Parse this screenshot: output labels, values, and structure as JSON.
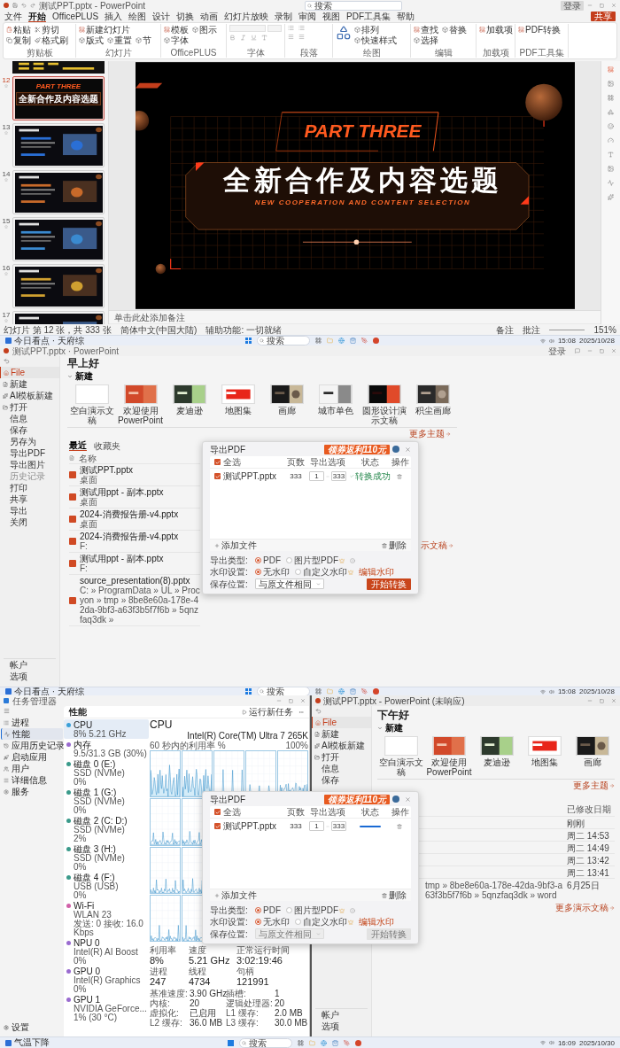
{
  "editor": {
    "title": "测试PPT.pptx - PowerPoint",
    "search_placeholder": "搜索",
    "sign_in": "登录",
    "menu_tabs": [
      {
        "label": "文件",
        "selected": false
      },
      {
        "label": "开始",
        "selected": true
      },
      {
        "label": "OfficePLUS",
        "selected": false
      },
      {
        "label": "插入",
        "selected": false
      },
      {
        "label": "绘图",
        "selected": false
      },
      {
        "label": "设计",
        "selected": false
      },
      {
        "label": "切换",
        "selected": false
      },
      {
        "label": "动画",
        "selected": false
      },
      {
        "label": "幻灯片放映",
        "selected": false
      },
      {
        "label": "录制",
        "selected": false
      },
      {
        "label": "审阅",
        "selected": false
      },
      {
        "label": "视图",
        "selected": false
      },
      {
        "label": "PDF工具集",
        "selected": false
      },
      {
        "label": "帮助",
        "selected": false
      }
    ],
    "share": "共享",
    "ribbon_groups": [
      {
        "label": "剪贴板",
        "kind": "buttons",
        "buttons": [
          "粘贴",
          "剪切",
          "复制",
          "格式刷"
        ]
      },
      {
        "label": "幻灯片",
        "kind": "buttons",
        "buttons": [
          "新建幻灯片",
          "版式",
          "重置",
          "节"
        ]
      },
      {
        "label": "OfficePLUS",
        "kind": "buttons",
        "buttons": [
          "模板",
          "图示",
          "字体"
        ]
      },
      {
        "label": "字体",
        "kind": "font"
      },
      {
        "label": "段落",
        "kind": "paragraph"
      },
      {
        "label": "绘图",
        "kind": "drawing",
        "buttons": [
          "排列",
          "快速样式"
        ]
      },
      {
        "label": "编辑",
        "kind": "buttons",
        "buttons": [
          "查找",
          "替换",
          "选择"
        ]
      },
      {
        "label": "加载项",
        "kind": "buttons",
        "buttons": [
          "加载项"
        ]
      },
      {
        "label": "PDF工具集",
        "kind": "buttons",
        "buttons": [
          "PDF转换"
        ]
      }
    ],
    "thumbnails": [
      {
        "number": "12",
        "selected": true,
        "kind": "title",
        "part": "PART THREE",
        "title": "全新合作及内容选题"
      },
      {
        "number": "13",
        "selected": false,
        "kind": "picture"
      },
      {
        "number": "14",
        "selected": false,
        "kind": "picture"
      },
      {
        "number": "15",
        "selected": false,
        "kind": "picture"
      },
      {
        "number": "16",
        "selected": false,
        "kind": "picture"
      },
      {
        "number": "17",
        "selected": false,
        "kind": "picture"
      }
    ],
    "slide": {
      "part": "PART THREE",
      "title": "全新合作及内容选题",
      "subtitle": "NEW COOPERATION AND CONTENT SELECTION"
    },
    "notes_placeholder": "单击此处添加备注",
    "status_bar": {
      "slide": "幻灯片 第 12 张，共 333 张",
      "language": "简体中文(中国大陆)",
      "accessibility": "辅助功能: 一切就绪",
      "notes": "备注",
      "comments": "批注",
      "zoom": "151%"
    }
  },
  "taskbar_1": {
    "news": "今日看点 · 天府综",
    "search_placeholder": "搜索",
    "time": "15:08",
    "date": "2025/10/28"
  },
  "backstage": {
    "title": "测试PPT.pptx · PowerPoint",
    "sign_in": "登录",
    "greeting": "早上好",
    "new_heading": "新建",
    "nav": [
      {
        "label": "File",
        "selected": true,
        "disabled": false
      },
      {
        "label": "新建",
        "selected": false,
        "disabled": false
      },
      {
        "label": "AI模板新建",
        "selected": false,
        "disabled": false
      },
      {
        "label": "打开",
        "selected": false,
        "disabled": false
      },
      {
        "label": "信息",
        "selected": false,
        "disabled": false
      },
      {
        "label": "保存",
        "selected": false,
        "disabled": false
      },
      {
        "label": "另存为",
        "selected": false,
        "disabled": false
      },
      {
        "label": "导出PDF",
        "selected": false,
        "disabled": false
      },
      {
        "label": "导出图片",
        "selected": false,
        "disabled": false
      },
      {
        "label": "历史记录",
        "selected": false,
        "disabled": true
      },
      {
        "label": "打印",
        "selected": false,
        "disabled": false
      },
      {
        "label": "共享",
        "selected": false,
        "disabled": false
      },
      {
        "label": "导出",
        "selected": false,
        "disabled": false
      },
      {
        "label": "关闭",
        "selected": false,
        "disabled": false
      }
    ],
    "nav_bottom": [
      "帐户",
      "选项"
    ],
    "templates": [
      "空白演示文稿",
      "欢迎使用 PowerPoint",
      "麦迪逊",
      "地图集",
      "画廊",
      "城市单色",
      "圆形设计演示文稿",
      "积尘画廊"
    ],
    "more_themes": "更多主题",
    "tabs": [
      {
        "label": "最近",
        "selected": true
      },
      {
        "label": "收藏夹",
        "selected": false
      }
    ],
    "name_column": "名称",
    "files": [
      {
        "name": "测试PPT.pptx",
        "location": "桌面"
      },
      {
        "name": "测试用ppt - 副本.pptx",
        "location": "桌面"
      },
      {
        "name": "2024-消费报告册-v4.pptx",
        "location": "桌面"
      },
      {
        "name": "2024-消费报告册-v4.pptx",
        "location": "F:"
      },
      {
        "name": "测试用ppt - 副本.pptx",
        "location": "F:"
      },
      {
        "name": "source_presentation(8).pptx",
        "location": "C: » ProgramData » UL » Procyon » tmp » 8be8e60a-178e-42da-9bf3-a63f3b5f7f6b » 5qnzfaq3dk »"
      }
    ],
    "more_files": "示文稿"
  },
  "export_dialog_1": {
    "title": "导出PDF",
    "promo": "领券返利110元",
    "columns": [
      "全选",
      "页数",
      "导出选项",
      "状态",
      "操作"
    ],
    "select_all": true,
    "files": [
      {
        "name": "测试PPT.pptx",
        "checked": true,
        "pages": "333",
        "from": "1",
        "to": "333",
        "status": {
          "kind": "done",
          "text": "转换成功"
        }
      }
    ],
    "add_file": "添加文件",
    "delete": "删除",
    "export_type": {
      "label": "导出类型:",
      "options": [
        {
          "label": "PDF",
          "selected": true,
          "premium": false
        },
        {
          "label": "图片型PDF",
          "selected": false,
          "premium": true
        }
      ]
    },
    "watermark": {
      "label": "水印设置:",
      "options": [
        {
          "label": "无水印",
          "selected": true,
          "premium": false
        },
        {
          "label": "自定义水印",
          "selected": false,
          "premium": true
        }
      ],
      "edit": "编辑水印"
    },
    "save_location": {
      "label": "保存位置:",
      "value": "与原文件相同",
      "disabled": false
    },
    "start": {
      "label": "开始转换",
      "disabled": false
    }
  },
  "taskbar_2": {
    "news": "今日看点 · 天府综",
    "search_placeholder": "搜索",
    "time": "15:08",
    "date": "2025/10/28"
  },
  "task_manager": {
    "title": "任务管理器",
    "nav": [
      {
        "label": "进程",
        "selected": false
      },
      {
        "label": "性能",
        "selected": true
      },
      {
        "label": "应用历史记录",
        "selected": false
      },
      {
        "label": "启动应用",
        "selected": false
      },
      {
        "label": "用户",
        "selected": false
      },
      {
        "label": "详细信息",
        "selected": false
      },
      {
        "label": "服务",
        "selected": false
      }
    ],
    "settings": "设置",
    "header": "性能",
    "run_task": "运行新任务",
    "devices": [
      {
        "name": "CPU",
        "lines": [
          "8% 5.21 GHz"
        ],
        "selected": true,
        "color": "#3aa0d8"
      },
      {
        "name": "内存",
        "lines": [
          "9.5/31.3 GB (30%)"
        ],
        "selected": false,
        "color": "#9a6bd0"
      },
      {
        "name": "磁盘 0 (E:)",
        "lines": [
          "SSD (NVMe)",
          "0%"
        ],
        "selected": false,
        "color": "#3a9a8a"
      },
      {
        "name": "磁盘 1 (G:)",
        "lines": [
          "SSD (NVMe)",
          "0%"
        ],
        "selected": false,
        "color": "#3a9a8a"
      },
      {
        "name": "磁盘 2 (C: D:)",
        "lines": [
          "SSD (NVMe)",
          "2%"
        ],
        "selected": false,
        "color": "#3a9a8a"
      },
      {
        "name": "磁盘 3 (H:)",
        "lines": [
          "SSD (NVMe)",
          "0%"
        ],
        "selected": false,
        "color": "#3a9a8a"
      },
      {
        "name": "磁盘 4 (F:)",
        "lines": [
          "USB (USB)",
          "0%"
        ],
        "selected": false,
        "color": "#3a9a8a"
      },
      {
        "name": "Wi-Fi",
        "lines": [
          "WLAN 23",
          "发送: 0 接收: 16.0 Kbps"
        ],
        "selected": false,
        "color": "#d060a8"
      },
      {
        "name": "NPU 0",
        "lines": [
          "Intel(R) AI Boost",
          "0%"
        ],
        "selected": false,
        "color": "#9a6bd0"
      },
      {
        "name": "GPU 0",
        "lines": [
          "Intel(R) Graphics",
          "0%"
        ],
        "selected": false,
        "color": "#9a6bd0"
      },
      {
        "name": "GPU 1",
        "lines": [
          "NVIDIA GeForce...",
          "1% (30 °C)"
        ],
        "selected": false,
        "color": "#9a6bd0"
      }
    ],
    "cpu": {
      "title": "CPU",
      "model": "Intel(R) Core(TM) Ultra 7 265K",
      "graph_label": "60 秒内的利用率 %",
      "graph_max": "100%",
      "stats": [
        {
          "label": "利用率",
          "value": "8%"
        },
        {
          "label": "速度",
          "value": "5.21 GHz"
        },
        {
          "label": "正常运行时间",
          "value": "3:02:19:46"
        },
        {
          "label": "进程",
          "value": "247"
        },
        {
          "label": "线程",
          "value": "4734"
        },
        {
          "label": "句柄",
          "value": "121991"
        }
      ],
      "specs": [
        {
          "label": "基准速度:",
          "value": "3.90 GHz"
        },
        {
          "label": "插槽:",
          "value": "1"
        },
        {
          "label": "内核:",
          "value": "20"
        },
        {
          "label": "逻辑处理器:",
          "value": "20"
        },
        {
          "label": "虚拟化:",
          "value": "已启用"
        },
        {
          "label": "L1 缓存:",
          "value": "2.0 MB"
        },
        {
          "label": "L2 缓存:",
          "value": "36.0 MB"
        },
        {
          "label": "L3 缓存:",
          "value": "30.0 MB"
        }
      ]
    }
  },
  "backstage_2": {
    "title": "测试PPT.pptx - PowerPoint (未响应)",
    "greeting": "下午好",
    "new_heading": "新建",
    "nav": [
      {
        "label": "File",
        "selected": true
      },
      {
        "label": "新建",
        "selected": false
      },
      {
        "label": "AI模板新建",
        "selected": false
      },
      {
        "label": "打开",
        "selected": false
      },
      {
        "label": "信息",
        "selected": false
      },
      {
        "label": "保存",
        "selected": false
      }
    ],
    "nav_bottom": [
      "帐户",
      "选项"
    ],
    "templates": [
      "空白演示文稿",
      "欢迎使用 PowerPoint",
      "麦迪逊",
      "地图集",
      "画廊"
    ],
    "more_themes": "更多主题",
    "date_column": "已修改日期",
    "dates": [
      "刚刚",
      "周二 14:53",
      "周二 14:49",
      "周二 13:42",
      "周二 13:41",
      "6月25日"
    ],
    "path_tail": "tmp » 8be8e60a-178e-42da-9bf3-a63f3b5f7f6b » 5qnzfaq3dk » word",
    "more_files": "更多演示文稿"
  },
  "export_dialog_2": {
    "title": "导出PDF",
    "promo": "领券返利110元",
    "columns": [
      "全选",
      "页数",
      "导出选项",
      "状态",
      "操作"
    ],
    "select_all": true,
    "files": [
      {
        "name": "测试PPT.pptx",
        "checked": true,
        "pages": "333",
        "from": "1",
        "to": "333",
        "status": {
          "kind": "progress",
          "level": 1
        }
      }
    ],
    "add_file": "添加文件",
    "delete": "删除",
    "export_type": {
      "label": "导出类型:",
      "options": [
        {
          "label": "PDF",
          "selected": true,
          "premium": false
        },
        {
          "label": "图片型PDF",
          "selected": false,
          "premium": true
        }
      ]
    },
    "watermark": {
      "label": "水印设置:",
      "options": [
        {
          "label": "无水印",
          "selected": true,
          "premium": false
        },
        {
          "label": "自定义水印",
          "selected": false,
          "premium": true
        }
      ],
      "edit": "编辑水印"
    },
    "save_location": {
      "label": "保存位置:",
      "value": "与原文件相同",
      "disabled": true
    },
    "start": {
      "label": "开始转换",
      "disabled": true
    }
  },
  "taskbar_3": {
    "news": "气温下降",
    "search_placeholder": "搜索",
    "time": "16:09",
    "date": "2025/10/30"
  }
}
